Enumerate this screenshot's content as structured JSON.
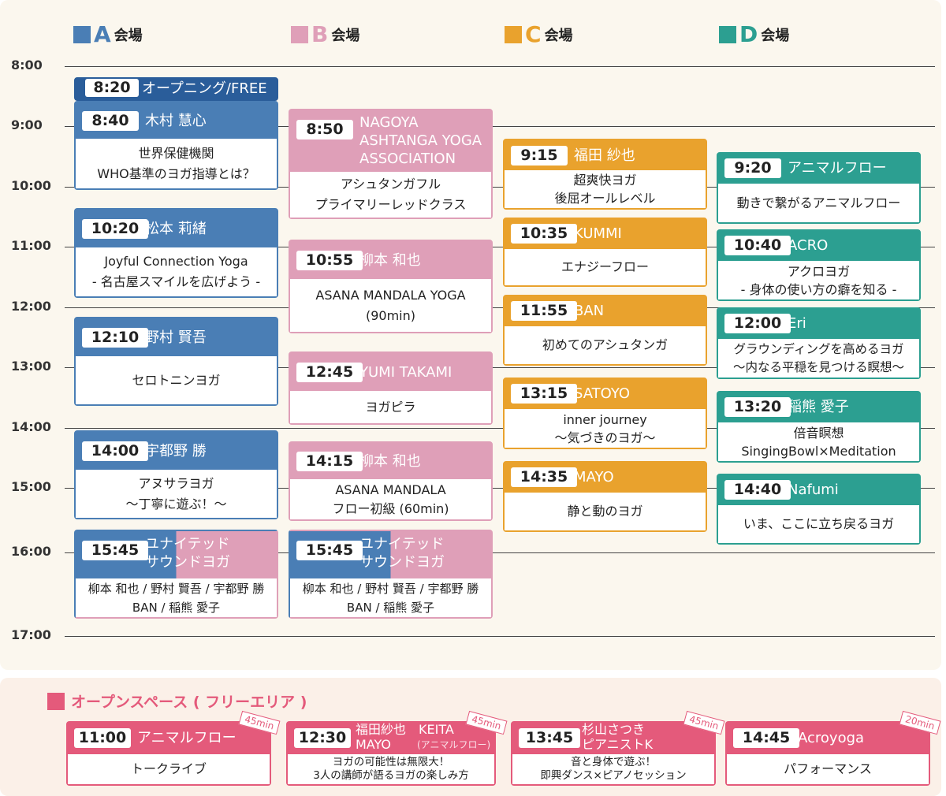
{
  "venues": [
    {
      "letter": "A",
      "label": "会場",
      "color": "#4a7eb5"
    },
    {
      "letter": "B",
      "label": "会場",
      "color": "#df9fb8"
    },
    {
      "letter": "C",
      "label": "会場",
      "color": "#e9a22d"
    },
    {
      "letter": "D",
      "label": "会場",
      "color": "#2c9f91"
    }
  ],
  "times": [
    "8:00",
    "9:00",
    "10:00",
    "11:00",
    "12:00",
    "13:00",
    "14:00",
    "15:00",
    "16:00",
    "17:00"
  ],
  "colA": [
    {
      "time": "8:20",
      "name": "オープニング/FREE"
    },
    {
      "time": "8:40",
      "name": "木村 慧心",
      "lines": [
        "世界保健機関",
        "WHO基準のヨガ指導とは？"
      ]
    },
    {
      "time": "10:20",
      "name": "松本 莉緒",
      "lines": [
        "Joyful Connection Yoga",
        "- 名古屋スマイルを広げよう -"
      ]
    },
    {
      "time": "12:10",
      "name": "野村 賢吾",
      "lines": [
        "セロトニンヨガ"
      ]
    },
    {
      "time": "14:00",
      "name": "宇都野 勝",
      "lines": [
        "アヌサラヨガ",
        "〜丁寧に遊ぶ！〜"
      ]
    },
    {
      "time": "15:45",
      "name1": "ユナイテッド",
      "name2": "サウンドヨガ",
      "lines": [
        "柳本 和也 / 野村 賢吾 / 宇都野 勝",
        "BAN / 稲熊 愛子"
      ]
    }
  ],
  "colB": [
    {
      "time": "8:50",
      "name1": "NAGOYA",
      "name2": "ASHTANGA YOGA",
      "name3": "ASSOCIATION",
      "lines": [
        "アシュタンガフル",
        "プライマリーレッドクラス"
      ]
    },
    {
      "time": "10:55",
      "name": "柳本 和也",
      "lines": [
        "ASANA MANDALA YOGA",
        "(90min)"
      ]
    },
    {
      "time": "12:45",
      "name": "YUMI TAKAMI",
      "lines": [
        "ヨガピラ"
      ]
    },
    {
      "time": "14:15",
      "name": "柳本 和也",
      "lines": [
        "ASANA MANDALA",
        "フロー初級 (60min)"
      ]
    },
    {
      "time": "15:45",
      "name1": "ユナイテッド",
      "name2": "サウンドヨガ",
      "lines": [
        "柳本 和也 / 野村 賢吾 / 宇都野 勝",
        "BAN / 稲熊 愛子"
      ]
    }
  ],
  "colC": [
    {
      "time": "9:15",
      "name": "福田 紗也",
      "lines": [
        "超爽快ヨガ",
        "後屈オールレベル"
      ]
    },
    {
      "time": "10:35",
      "name": "KUMMI",
      "lines": [
        "エナジーフロー"
      ]
    },
    {
      "time": "11:55",
      "name": "BAN",
      "lines": [
        "初めてのアシュタンガ"
      ]
    },
    {
      "time": "13:15",
      "name": "SATOYO",
      "lines": [
        "inner journey",
        "〜気づきのヨガ〜"
      ]
    },
    {
      "time": "14:35",
      "name": "MAYO",
      "lines": [
        "静と動のヨガ"
      ]
    }
  ],
  "colD": [
    {
      "time": "9:20",
      "name": "アニマルフロー",
      "lines": [
        "動きで繋がるアニマルフロー"
      ]
    },
    {
      "time": "10:40",
      "name": "ACRO",
      "lines": [
        "アクロヨガ",
        "- 身体の使い方の癖を知る -"
      ]
    },
    {
      "time": "12:00",
      "name": "Eri",
      "lines": [
        "グラウンディングを高めるヨガ",
        "〜内なる平穏を見つける瞑想〜"
      ]
    },
    {
      "time": "13:20",
      "name": "稲熊 愛子",
      "lines": [
        "倍音瞑想",
        "SingingBowl×Meditation"
      ]
    },
    {
      "time": "14:40",
      "name": "Nafumi",
      "lines": [
        "いま、ここに立ち戻るヨガ"
      ]
    }
  ],
  "open": {
    "title": "オープンスペース ( フリーエリア )",
    "color": "#e45a7b",
    "items": [
      {
        "time": "11:00",
        "name": "アニマルフロー",
        "dur": "45min",
        "lines": [
          "トークライブ"
        ]
      },
      {
        "time": "12:30",
        "name1": "福田紗也",
        "name1b": "KEITA",
        "name2": "MAYO",
        "name2b": "(アニマルフロー)",
        "dur": "45min",
        "lines": [
          "ヨガの可能性は無限大！",
          "3人の講師が語るヨガの楽しみ方"
        ]
      },
      {
        "time": "13:45",
        "name1": "杉山さつき",
        "name2": "ピアニストK",
        "dur": "45min",
        "lines": [
          "音と身体で遊ぶ！",
          "即興ダンス×ピアノセッション"
        ]
      },
      {
        "time": "14:45",
        "name": "Acroyoga",
        "dur": "20min",
        "lines": [
          "パフォーマンス"
        ]
      }
    ]
  }
}
